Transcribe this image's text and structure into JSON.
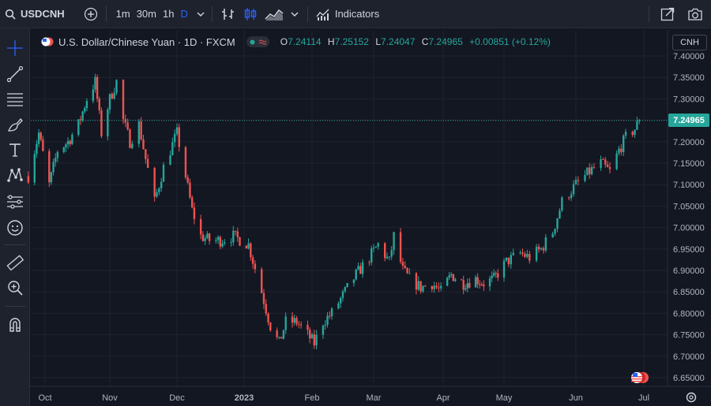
{
  "toolbar": {
    "symbol": "USDCNH",
    "timeframes": [
      "1m",
      "30m",
      "1h",
      "D"
    ],
    "active_timeframe": "D",
    "indicators_label": "Indicators"
  },
  "legend": {
    "title": "U.S. Dollar/Chinese Yuan · 1D · FXCM",
    "o_label": "O",
    "o_value": "7.24114",
    "h_label": "H",
    "h_value": "7.25152",
    "l_label": "L",
    "l_value": "7.24047",
    "c_label": "C",
    "c_value": "7.24965",
    "change": "+0.00851 (+0.12%)"
  },
  "currency_button": "CNH",
  "last_price_label": "7.24965",
  "colors": {
    "up": "#26a69a",
    "down": "#ef5350",
    "accent": "#2962ff",
    "background": "#131722"
  },
  "sidebar_tools": [
    "crosshair-icon",
    "trend-line-icon",
    "fib-lines-icon",
    "brush-icon",
    "text-icon",
    "pattern-icon",
    "prediction-icon",
    "emoji-icon",
    "ruler-icon",
    "zoom-in-icon",
    "magnet-icon"
  ],
  "chart_data": {
    "type": "candlestick",
    "y_ticks": [
      "7.40000",
      "7.35000",
      "7.30000",
      "7.25000",
      "7.20000",
      "7.15000",
      "7.10000",
      "7.05000",
      "7.00000",
      "6.95000",
      "6.90000",
      "6.85000",
      "6.80000",
      "6.75000",
      "6.70000",
      "6.65000"
    ],
    "x_ticks": [
      "Oct",
      "Nov",
      "Dec",
      "2023",
      "Feb",
      "Mar",
      "Apr",
      "May",
      "Jun",
      "Jul"
    ],
    "ylim": [
      6.64,
      7.42
    ],
    "last_price": 7.24965,
    "close_path": [
      [
        "2022-09-23",
        7.12
      ],
      [
        "2022-09-28",
        7.22
      ],
      [
        "2022-10-03",
        7.1
      ],
      [
        "2022-10-07",
        7.18
      ],
      [
        "2022-10-12",
        7.2
      ],
      [
        "2022-10-17",
        7.24
      ],
      [
        "2022-10-21",
        7.3
      ],
      [
        "2022-10-25",
        7.34
      ],
      [
        "2022-10-28",
        7.22
      ],
      [
        "2022-11-01",
        7.3
      ],
      [
        "2022-11-04",
        7.34
      ],
      [
        "2022-11-07",
        7.25
      ],
      [
        "2022-11-10",
        7.2
      ],
      [
        "2022-11-14",
        7.24
      ],
      [
        "2022-11-17",
        7.16
      ],
      [
        "2022-11-21",
        7.06
      ],
      [
        "2022-11-25",
        7.14
      ],
      [
        "2022-11-28",
        7.18
      ],
      [
        "2022-12-01",
        7.22
      ],
      [
        "2022-12-05",
        7.12
      ],
      [
        "2022-12-08",
        7.04
      ],
      [
        "2022-12-12",
        6.98
      ],
      [
        "2022-12-16",
        6.97
      ],
      [
        "2022-12-21",
        6.97
      ],
      [
        "2022-12-27",
        6.98
      ],
      [
        "2023-01-03",
        6.96
      ],
      [
        "2023-01-09",
        6.85
      ],
      [
        "2023-01-13",
        6.77
      ],
      [
        "2023-01-17",
        6.73
      ],
      [
        "2023-01-20",
        6.78
      ],
      [
        "2023-01-25",
        6.78
      ],
      [
        "2023-01-30",
        6.75
      ],
      [
        "2023-02-02",
        6.73
      ],
      [
        "2023-02-06",
        6.78
      ],
      [
        "2023-02-10",
        6.8
      ],
      [
        "2023-02-16",
        6.85
      ],
      [
        "2023-02-21",
        6.89
      ],
      [
        "2023-02-27",
        6.93
      ],
      [
        "2023-03-03",
        6.96
      ],
      [
        "2023-03-08",
        6.92
      ],
      [
        "2023-03-10",
        6.98
      ],
      [
        "2023-03-14",
        6.9
      ],
      [
        "2023-03-17",
        6.88
      ],
      [
        "2023-03-22",
        6.86
      ],
      [
        "2023-03-27",
        6.87
      ],
      [
        "2023-03-31",
        6.85
      ],
      [
        "2023-04-05",
        6.89
      ],
      [
        "2023-04-11",
        6.87
      ],
      [
        "2023-04-17",
        6.88
      ],
      [
        "2023-04-21",
        6.87
      ],
      [
        "2023-04-26",
        6.88
      ],
      [
        "2023-05-02",
        6.92
      ],
      [
        "2023-05-08",
        6.94
      ],
      [
        "2023-05-12",
        6.93
      ],
      [
        "2023-05-17",
        6.95
      ],
      [
        "2023-05-22",
        6.99
      ],
      [
        "2023-05-26",
        7.06
      ],
      [
        "2023-06-01",
        7.1
      ],
      [
        "2023-06-07",
        7.13
      ],
      [
        "2023-06-12",
        7.15
      ],
      [
        "2023-06-16",
        7.13
      ],
      [
        "2023-06-20",
        7.18
      ],
      [
        "2023-06-23",
        7.21
      ],
      [
        "2023-06-27",
        7.23
      ],
      [
        "2023-06-29",
        7.24965
      ]
    ]
  }
}
